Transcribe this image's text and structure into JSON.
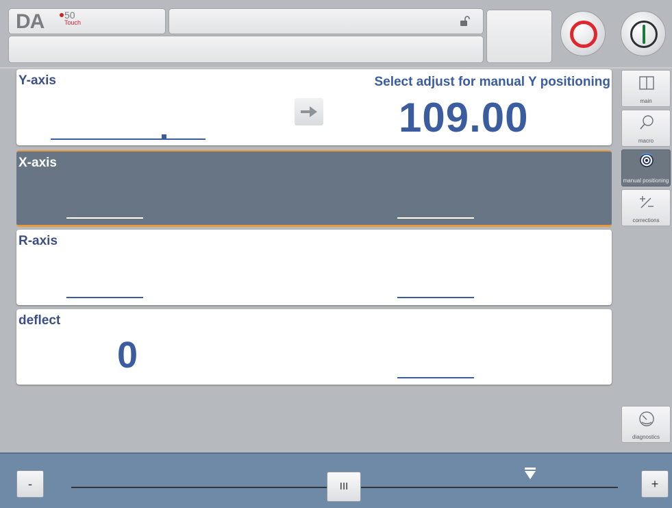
{
  "header": {
    "logo_main": "DA",
    "logo_model": "50",
    "logo_sub": "Touch",
    "status_text": "",
    "message_text": ""
  },
  "panels": [
    {
      "id": "y",
      "title": "Y-axis",
      "hint": "Select adjust for manual Y positioning",
      "actual_value": "109.00",
      "selected": false
    },
    {
      "id": "x",
      "title": "X-axis",
      "selected": true
    },
    {
      "id": "r",
      "title": "R-axis",
      "selected": false
    },
    {
      "id": "deflect",
      "title": "deflect",
      "value": "0",
      "selected": false
    }
  ],
  "nav": [
    {
      "label": "main",
      "icon": "book-icon",
      "active": false
    },
    {
      "label": "macro",
      "icon": "magnifier-icon",
      "active": false
    },
    {
      "label": "manual positioning",
      "icon": "handwheel-icon",
      "active": true
    },
    {
      "label": "corrections",
      "icon": "plus-minus-icon",
      "active": false
    },
    {
      "label": "diagnostics",
      "icon": "gauge-icon",
      "active": false
    }
  ],
  "slider": {
    "minus_label": "-",
    "plus_label": "+",
    "knob_label": "III",
    "knob_position_fraction": 0.47,
    "marker_position_fraction": 0.83
  },
  "colors": {
    "accent_blue": "#3b5da0",
    "selected_panel": "#687584",
    "selected_border": "#e89a3c",
    "stop_red": "#e0262f",
    "start_green": "#1f7a3a",
    "bottom_bar": "#6f8aa7"
  }
}
